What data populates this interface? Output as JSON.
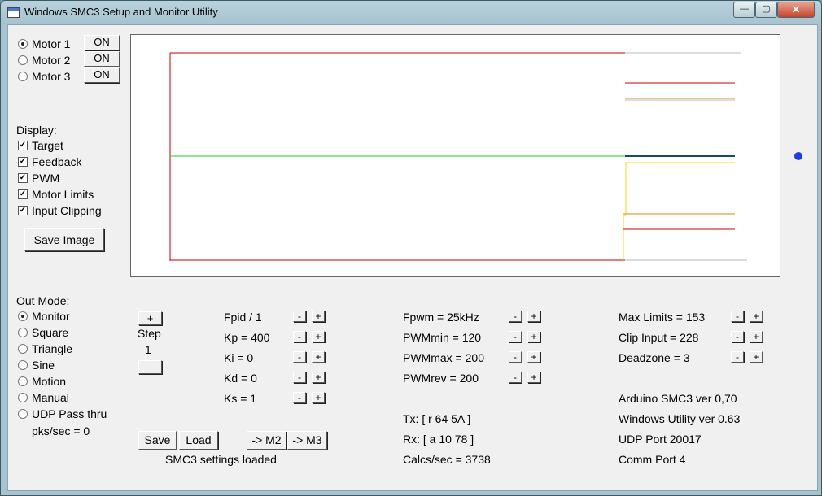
{
  "window": {
    "title": "Windows SMC3 Setup and Monitor Utility",
    "minimize": "—",
    "maximize": "▢",
    "close": "✕"
  },
  "motors": [
    {
      "label": "Motor 1",
      "button": "ON",
      "selected": true
    },
    {
      "label": "Motor 2",
      "button": "ON",
      "selected": false
    },
    {
      "label": "Motor 3",
      "button": "ON",
      "selected": false
    }
  ],
  "display": {
    "heading": "Display:",
    "options": [
      {
        "label": "Target",
        "checked": true
      },
      {
        "label": "Feedback",
        "checked": true
      },
      {
        "label": "PWM",
        "checked": true
      },
      {
        "label": "Motor Limits",
        "checked": true
      },
      {
        "label": "Input Clipping",
        "checked": true
      }
    ],
    "save_image": "Save Image"
  },
  "out_mode": {
    "heading": "Out Mode:",
    "options": [
      {
        "label": "Monitor",
        "selected": true
      },
      {
        "label": "Square",
        "selected": false
      },
      {
        "label": "Triangle",
        "selected": false
      },
      {
        "label": "Sine",
        "selected": false
      },
      {
        "label": "Motion",
        "selected": false
      },
      {
        "label": "Manual",
        "selected": false
      },
      {
        "label": "UDP Pass thru",
        "selected": false
      }
    ],
    "pks": "pks/sec = 0"
  },
  "step": {
    "plus": "+",
    "label": "Step",
    "value": "1",
    "minus": "-"
  },
  "pid": [
    "Fpid / 1",
    "Kp = 400",
    "Ki = 0",
    "Kd = 0",
    "Ks = 1"
  ],
  "pwm": [
    "Fpwm = 25kHz",
    "PWMmin = 120",
    "PWMmax = 200",
    "PWMrev = 200"
  ],
  "limits": [
    "Max Limits = 153",
    "Clip Input = 228",
    "Deadzone = 3"
  ],
  "adjust": {
    "minus": "-",
    "plus": "+"
  },
  "comms": {
    "tx": "Tx: [ r 64 5A ]",
    "rx": "Rx: [ a 10 78 ]",
    "calcs": "Calcs/sec = 3738"
  },
  "info": [
    "Arduino SMC3 ver 0,70",
    "Windows Utility ver 0.63",
    "UDP Port 20017",
    "Comm Port 4"
  ],
  "actions": {
    "save": "Save",
    "load": "Load",
    "to_m2": "-> M2",
    "to_m3": "-> M3",
    "status": "SMC3 settings loaded"
  },
  "colors": {
    "target": "#cc0000",
    "feedback": "#00cc00",
    "pwm": "#ffd700",
    "limits": "#e08a00",
    "clipping": "#cc0000",
    "slider": "#1c3cf0"
  }
}
